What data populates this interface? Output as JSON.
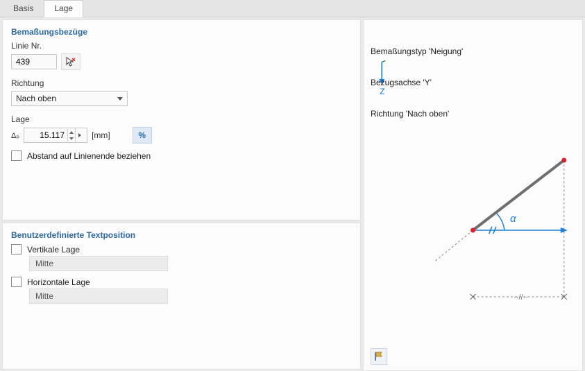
{
  "tabs": {
    "basis": "Basis",
    "lage": "Lage",
    "active": "lage"
  },
  "ref": {
    "title": "Bemaßungsbezüge",
    "linie_label": "Linie Nr.",
    "linie_value": "439",
    "richtung_label": "Richtung",
    "richtung_value": "Nach oben",
    "lage_label": "Lage",
    "delta_symbol": "Δₚ",
    "delta_value": "15.117",
    "unit": "[mm]",
    "pct_label": "%",
    "endpoint_chk": "Abstand auf Linienende beziehen"
  },
  "textpos": {
    "title": "Benutzerdefinierte Textposition",
    "v_label": "Vertikale Lage",
    "v_value": "Mitte",
    "h_label": "Horizontale Lage",
    "h_value": "Mitte"
  },
  "preview": {
    "line1": "Bemaßungstyp 'Neigung'",
    "line2": "Bezugsachse 'Y'",
    "line3": "Richtung 'Nach oben'",
    "alpha": "α",
    "z": "Z"
  }
}
